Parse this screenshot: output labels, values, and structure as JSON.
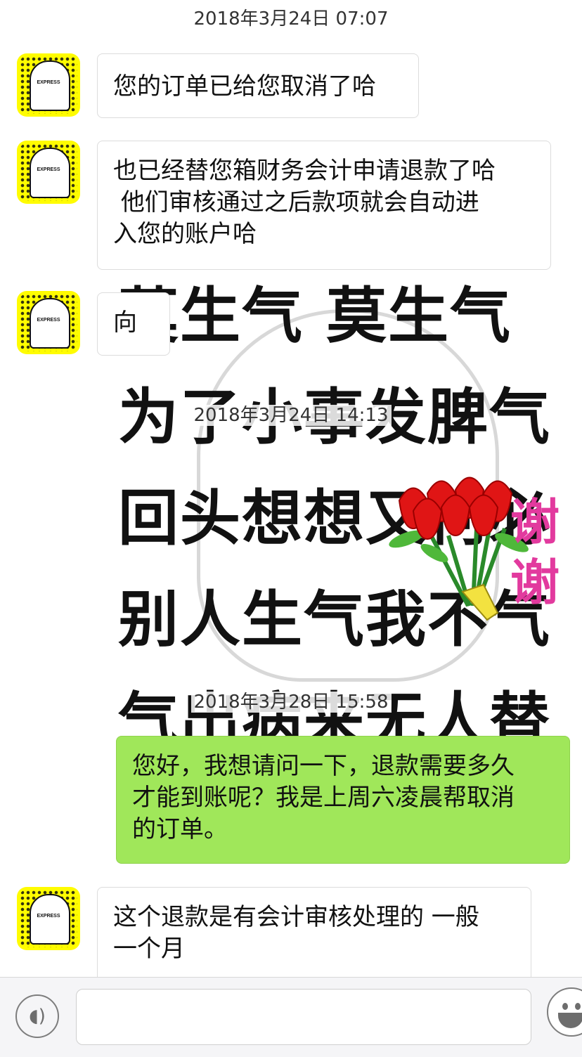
{
  "timestamps": [
    "2018年3月24日 07:07",
    "2018年3月24日 14:13",
    "2018年3月28日 15:58"
  ],
  "avatar_text": "EXPRESS",
  "messages": [
    {
      "side": "in",
      "text": "您的订单已给您取消了哈"
    },
    {
      "side": "in",
      "text": "也已经替您箱财务会计申请退款了哈\n 他们审核通过之后款项就会自动进\n入您的账户哈"
    },
    {
      "side": "in",
      "text": "向"
    },
    {
      "side": "out",
      "text": "您好，我想请问一下，退款需要多久\n才能到账呢？我是上周六凌晨帮取消\n的订单。"
    },
    {
      "side": "in",
      "text": "这个退款是有会计审核处理的 一般\n一个月"
    }
  ],
  "sticker_lines": [
    "莫生气 莫生气",
    "为了小事发脾气",
    "回头想想又何必",
    "别人生气我不气",
    "气出病来无人替"
  ],
  "flower_text": "谢谢",
  "input": {
    "value": "",
    "placeholder": ""
  },
  "icons": {
    "voice": "voice-icon",
    "emoji": "emoji-icon",
    "flower": "flower-bouquet-icon"
  },
  "colors": {
    "outgoing_bubble": "#a0e75a",
    "avatar_bg": "#fffc00",
    "thanks_text": "#e23a9e"
  }
}
